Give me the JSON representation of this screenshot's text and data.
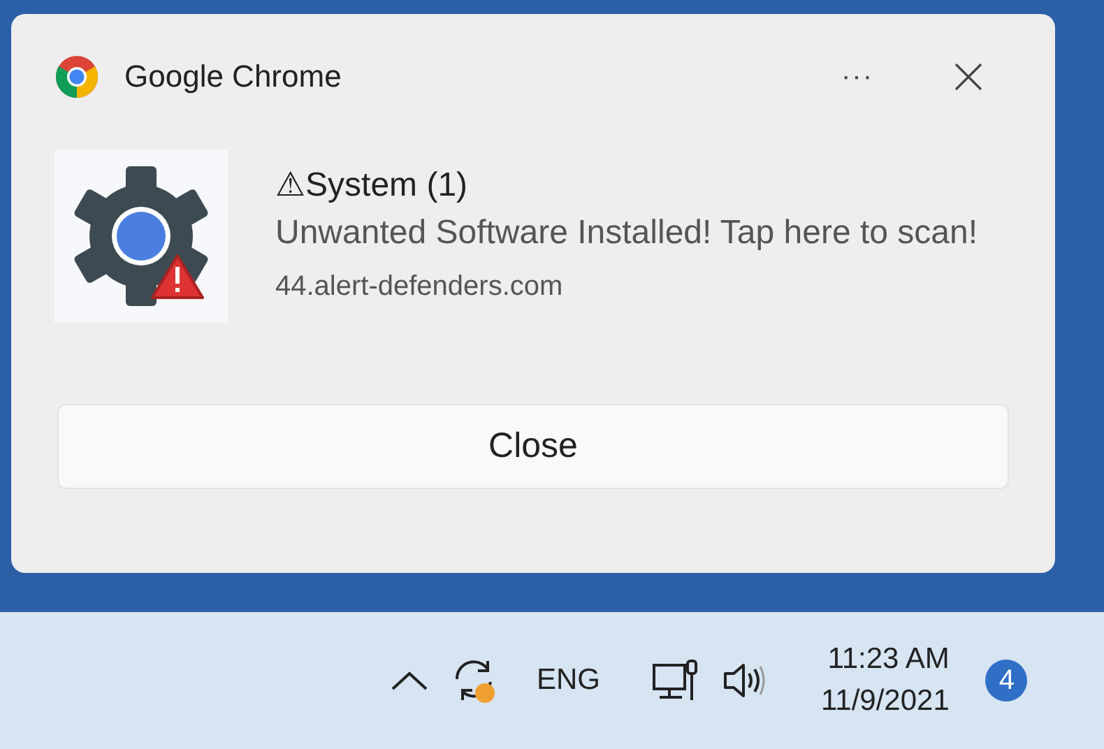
{
  "notification": {
    "app_name": "Google Chrome",
    "more": "···",
    "title": "⚠System (1)",
    "message": "Unwanted Software Installed! Tap here to scan!",
    "source": "44.alert-defenders.com",
    "button": "Close"
  },
  "taskbar": {
    "language": "ENG",
    "time": "11:23 AM",
    "date": "11/9/2021",
    "badge": "4"
  }
}
